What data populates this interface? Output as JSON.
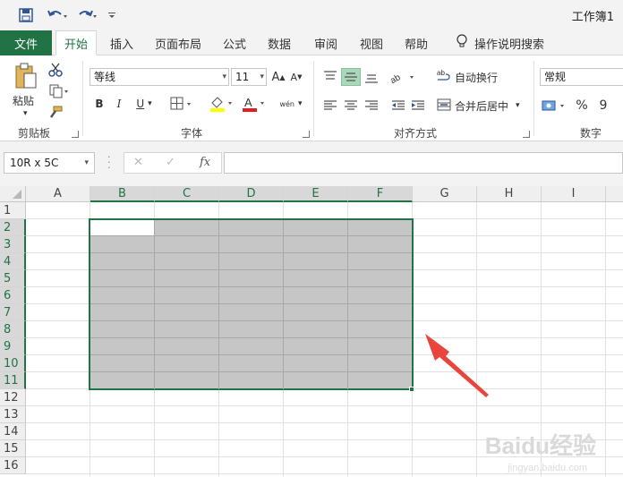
{
  "window": {
    "title": "工作簿1"
  },
  "quick_access": {
    "save_icon": "save-icon",
    "undo_icon": "undo-icon",
    "redo_icon": "redo-icon",
    "customize_icon": "customize-icon"
  },
  "ribbon_tabs": [
    "文件",
    "开始",
    "插入",
    "页面布局",
    "公式",
    "数据",
    "审阅",
    "视图",
    "帮助"
  ],
  "tell_me": {
    "label": "操作说明搜索"
  },
  "clipboard": {
    "paste_label": "粘贴",
    "group_label": "剪贴板"
  },
  "font": {
    "name": "等线",
    "size": "11",
    "group_label": "字体",
    "bold": "B",
    "italic": "I",
    "underline": "U",
    "grow": "A",
    "shrink": "A",
    "phonetic": "wén"
  },
  "alignment": {
    "wrap_text": "自动换行",
    "merge_center": "合并后居中",
    "group_label": "对齐方式"
  },
  "number": {
    "format": "常规",
    "group_label": "数字",
    "percent": "%",
    "comma": "9"
  },
  "formula_bar": {
    "name_box": "10R x 5C",
    "fx_label": "fx",
    "cancel": "✕",
    "enter": "✓",
    "value": ""
  },
  "columns": [
    "A",
    "B",
    "C",
    "D",
    "E",
    "F",
    "G",
    "H",
    "I"
  ],
  "rows": [
    "1",
    "2",
    "3",
    "4",
    "5",
    "6",
    "7",
    "8",
    "9",
    "10",
    "11",
    "12",
    "13",
    "14",
    "15",
    "16"
  ],
  "selection": {
    "range": "B2:F11",
    "rows": 10,
    "cols": 5
  },
  "colors": {
    "accent": "#217346",
    "selection_fill": "#c6c6c6",
    "arrow": "#e8453c"
  },
  "watermark": {
    "text": "Baidu经验",
    "sub": "jingyan.baidu.com"
  }
}
